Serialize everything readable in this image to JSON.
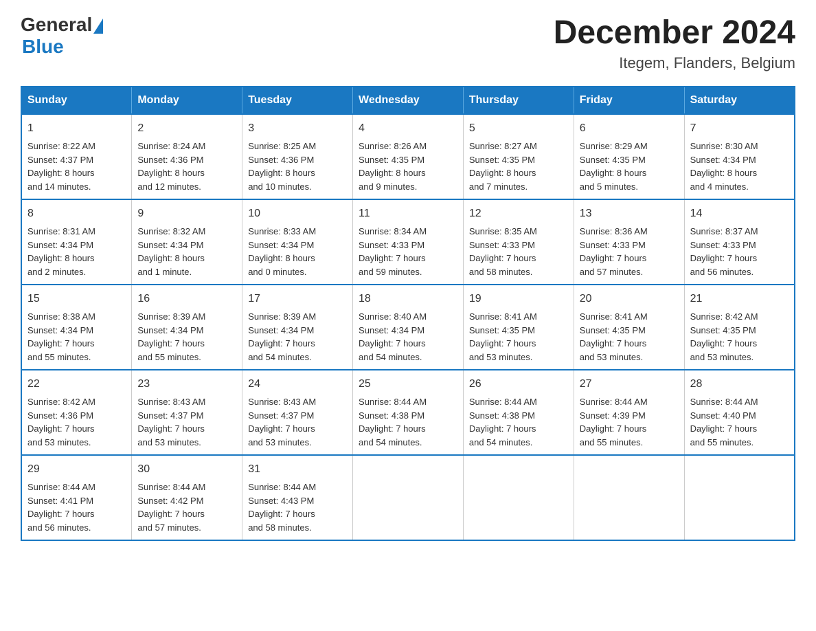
{
  "header": {
    "logo_general": "General",
    "logo_blue": "Blue",
    "month_year": "December 2024",
    "location": "Itegem, Flanders, Belgium"
  },
  "calendar": {
    "days_of_week": [
      "Sunday",
      "Monday",
      "Tuesday",
      "Wednesday",
      "Thursday",
      "Friday",
      "Saturday"
    ],
    "weeks": [
      [
        {
          "day": "1",
          "info": "Sunrise: 8:22 AM\nSunset: 4:37 PM\nDaylight: 8 hours\nand 14 minutes."
        },
        {
          "day": "2",
          "info": "Sunrise: 8:24 AM\nSunset: 4:36 PM\nDaylight: 8 hours\nand 12 minutes."
        },
        {
          "day": "3",
          "info": "Sunrise: 8:25 AM\nSunset: 4:36 PM\nDaylight: 8 hours\nand 10 minutes."
        },
        {
          "day": "4",
          "info": "Sunrise: 8:26 AM\nSunset: 4:35 PM\nDaylight: 8 hours\nand 9 minutes."
        },
        {
          "day": "5",
          "info": "Sunrise: 8:27 AM\nSunset: 4:35 PM\nDaylight: 8 hours\nand 7 minutes."
        },
        {
          "day": "6",
          "info": "Sunrise: 8:29 AM\nSunset: 4:35 PM\nDaylight: 8 hours\nand 5 minutes."
        },
        {
          "day": "7",
          "info": "Sunrise: 8:30 AM\nSunset: 4:34 PM\nDaylight: 8 hours\nand 4 minutes."
        }
      ],
      [
        {
          "day": "8",
          "info": "Sunrise: 8:31 AM\nSunset: 4:34 PM\nDaylight: 8 hours\nand 2 minutes."
        },
        {
          "day": "9",
          "info": "Sunrise: 8:32 AM\nSunset: 4:34 PM\nDaylight: 8 hours\nand 1 minute."
        },
        {
          "day": "10",
          "info": "Sunrise: 8:33 AM\nSunset: 4:34 PM\nDaylight: 8 hours\nand 0 minutes."
        },
        {
          "day": "11",
          "info": "Sunrise: 8:34 AM\nSunset: 4:33 PM\nDaylight: 7 hours\nand 59 minutes."
        },
        {
          "day": "12",
          "info": "Sunrise: 8:35 AM\nSunset: 4:33 PM\nDaylight: 7 hours\nand 58 minutes."
        },
        {
          "day": "13",
          "info": "Sunrise: 8:36 AM\nSunset: 4:33 PM\nDaylight: 7 hours\nand 57 minutes."
        },
        {
          "day": "14",
          "info": "Sunrise: 8:37 AM\nSunset: 4:33 PM\nDaylight: 7 hours\nand 56 minutes."
        }
      ],
      [
        {
          "day": "15",
          "info": "Sunrise: 8:38 AM\nSunset: 4:34 PM\nDaylight: 7 hours\nand 55 minutes."
        },
        {
          "day": "16",
          "info": "Sunrise: 8:39 AM\nSunset: 4:34 PM\nDaylight: 7 hours\nand 55 minutes."
        },
        {
          "day": "17",
          "info": "Sunrise: 8:39 AM\nSunset: 4:34 PM\nDaylight: 7 hours\nand 54 minutes."
        },
        {
          "day": "18",
          "info": "Sunrise: 8:40 AM\nSunset: 4:34 PM\nDaylight: 7 hours\nand 54 minutes."
        },
        {
          "day": "19",
          "info": "Sunrise: 8:41 AM\nSunset: 4:35 PM\nDaylight: 7 hours\nand 53 minutes."
        },
        {
          "day": "20",
          "info": "Sunrise: 8:41 AM\nSunset: 4:35 PM\nDaylight: 7 hours\nand 53 minutes."
        },
        {
          "day": "21",
          "info": "Sunrise: 8:42 AM\nSunset: 4:35 PM\nDaylight: 7 hours\nand 53 minutes."
        }
      ],
      [
        {
          "day": "22",
          "info": "Sunrise: 8:42 AM\nSunset: 4:36 PM\nDaylight: 7 hours\nand 53 minutes."
        },
        {
          "day": "23",
          "info": "Sunrise: 8:43 AM\nSunset: 4:37 PM\nDaylight: 7 hours\nand 53 minutes."
        },
        {
          "day": "24",
          "info": "Sunrise: 8:43 AM\nSunset: 4:37 PM\nDaylight: 7 hours\nand 53 minutes."
        },
        {
          "day": "25",
          "info": "Sunrise: 8:44 AM\nSunset: 4:38 PM\nDaylight: 7 hours\nand 54 minutes."
        },
        {
          "day": "26",
          "info": "Sunrise: 8:44 AM\nSunset: 4:38 PM\nDaylight: 7 hours\nand 54 minutes."
        },
        {
          "day": "27",
          "info": "Sunrise: 8:44 AM\nSunset: 4:39 PM\nDaylight: 7 hours\nand 55 minutes."
        },
        {
          "day": "28",
          "info": "Sunrise: 8:44 AM\nSunset: 4:40 PM\nDaylight: 7 hours\nand 55 minutes."
        }
      ],
      [
        {
          "day": "29",
          "info": "Sunrise: 8:44 AM\nSunset: 4:41 PM\nDaylight: 7 hours\nand 56 minutes."
        },
        {
          "day": "30",
          "info": "Sunrise: 8:44 AM\nSunset: 4:42 PM\nDaylight: 7 hours\nand 57 minutes."
        },
        {
          "day": "31",
          "info": "Sunrise: 8:44 AM\nSunset: 4:43 PM\nDaylight: 7 hours\nand 58 minutes."
        },
        {
          "day": "",
          "info": ""
        },
        {
          "day": "",
          "info": ""
        },
        {
          "day": "",
          "info": ""
        },
        {
          "day": "",
          "info": ""
        }
      ]
    ]
  }
}
